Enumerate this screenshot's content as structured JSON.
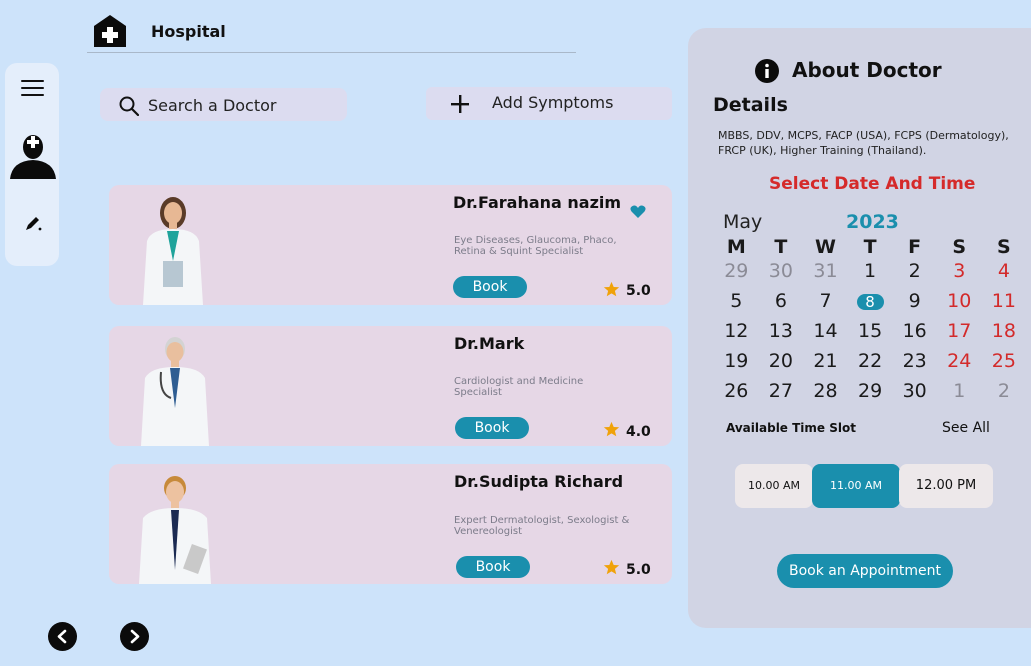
{
  "header": {
    "title": "Hospital"
  },
  "search": {
    "placeholder": "Search a Doctor"
  },
  "add_symptoms": {
    "label": "Add Symptoms"
  },
  "doctors": [
    {
      "name": "Dr.Farahana nazim",
      "specialty": "Eye Diseases, Glaucoma, Phaco, Retina & Squint Specialist",
      "book_label": "Book",
      "rating": "5.0",
      "favorite": true
    },
    {
      "name": "Dr.Mark",
      "specialty": "Cardiologist and Medicine Specialist",
      "book_label": "Book",
      "rating": "4.0",
      "favorite": false
    },
    {
      "name": "Dr.Sudipta Richard",
      "specialty": "Expert Dermatologist, Sexologist & Venereologist",
      "book_label": "Book",
      "rating": "5.0",
      "favorite": false
    }
  ],
  "panel": {
    "about_title": "About Doctor",
    "details_title": "Details",
    "details_text": "MBBS, DDV, MCPS, FACP (USA), FCPS (Dermatology), FRCP (UK), Higher Training (Thailand).",
    "select_title": "Select Date And Time",
    "calendar": {
      "month": "May",
      "year": "2023",
      "weekdays": [
        "M",
        "T",
        "W",
        "T",
        "F",
        "S",
        "S"
      ],
      "weeks": [
        [
          "29",
          "30",
          "31",
          "1",
          "2",
          "3",
          "4"
        ],
        [
          "5",
          "6",
          "7",
          "8",
          "9",
          "10",
          "11"
        ],
        [
          "12",
          "13",
          "14",
          "15",
          "16",
          "17",
          "18"
        ],
        [
          "19",
          "20",
          "21",
          "22",
          "23",
          "24",
          "25"
        ],
        [
          "26",
          "27",
          "28",
          "29",
          "30",
          "1",
          "2"
        ]
      ],
      "selected": "8"
    },
    "slot_title": "Available Time Slot",
    "see_all": "See All",
    "slots": [
      "10.00 AM",
      "11.00 AM",
      "12.00 PM"
    ],
    "selected_slot": "11.00 AM",
    "appointment_button": "Book an Appointment"
  },
  "colors": {
    "accent": "#1a8fad",
    "weekend": "#d32a2a",
    "background": "#cde3fa"
  }
}
